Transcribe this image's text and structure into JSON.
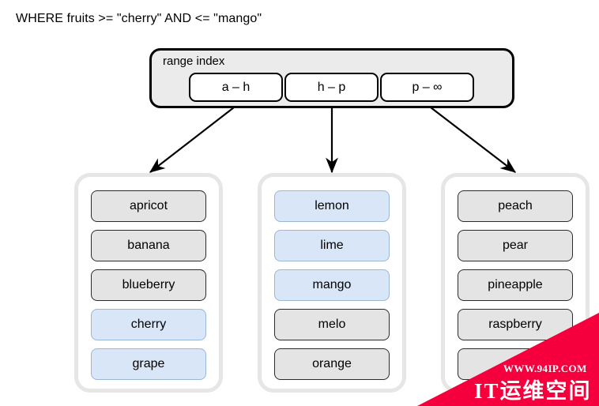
{
  "query": {
    "text": "WHERE fruits >= \"cherry\" AND <= \"mango\""
  },
  "range_index": {
    "title": "range index",
    "cells": [
      {
        "label": "a – h"
      },
      {
        "label": "h – p"
      },
      {
        "label": "p – ∞"
      }
    ]
  },
  "arrows": [
    {
      "name": "arrow-a-h-to-bucket-0"
    },
    {
      "name": "arrow-h-p-to-bucket-1"
    },
    {
      "name": "arrow-p-inf-to-bucket-2"
    }
  ],
  "buckets": [
    {
      "name": "bucket-a-h",
      "items": [
        {
          "label": "apricot",
          "match": false
        },
        {
          "label": "banana",
          "match": false
        },
        {
          "label": "blueberry",
          "match": false
        },
        {
          "label": "cherry",
          "match": true
        },
        {
          "label": "grape",
          "match": true
        }
      ]
    },
    {
      "name": "bucket-h-p",
      "items": [
        {
          "label": "lemon",
          "match": true
        },
        {
          "label": "lime",
          "match": true
        },
        {
          "label": "mango",
          "match": true
        },
        {
          "label": "melo",
          "match": false
        },
        {
          "label": "orange",
          "match": false
        }
      ]
    },
    {
      "name": "bucket-p-inf",
      "items": [
        {
          "label": "peach",
          "match": false
        },
        {
          "label": "pear",
          "match": false
        },
        {
          "label": "pineapple",
          "match": false
        },
        {
          "label": "raspberry",
          "match": false
        },
        {
          "label": "stra",
          "match": false
        }
      ]
    }
  ],
  "watermark": {
    "line1": "WWW.94IP.COM",
    "line2": "IT运维空间",
    "color": "#f5003c"
  },
  "colors": {
    "match_fill": "#d8e6f8",
    "item_fill": "#e4e4e4",
    "index_fill": "#ebebeb",
    "bucket_border": "#e6e6e6",
    "stroke": "#000000"
  }
}
